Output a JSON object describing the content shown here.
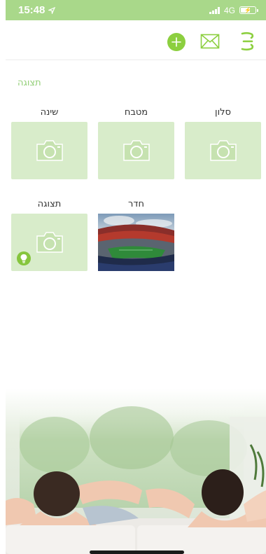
{
  "status_bar": {
    "time": "15:48",
    "network": "4G"
  },
  "header": {
    "add_icon": "plus-circle-icon",
    "mail_icon": "envelope-icon",
    "menu_icon": "hamburger-menu-icon"
  },
  "view_label": "תצוגה",
  "rooms": [
    {
      "label": "סלון",
      "type": "placeholder"
    },
    {
      "label": "מטבח",
      "type": "placeholder"
    },
    {
      "label": "שינה",
      "type": "placeholder"
    },
    {
      "label": "חדר",
      "type": "photo"
    },
    {
      "label": "תצוגה",
      "type": "placeholder",
      "badge": "bulb-icon"
    }
  ],
  "colors": {
    "accent": "#8ccf3f",
    "status_bar": "#a9d88a",
    "tile": "#d8ecca",
    "label_green": "#93cf78"
  }
}
